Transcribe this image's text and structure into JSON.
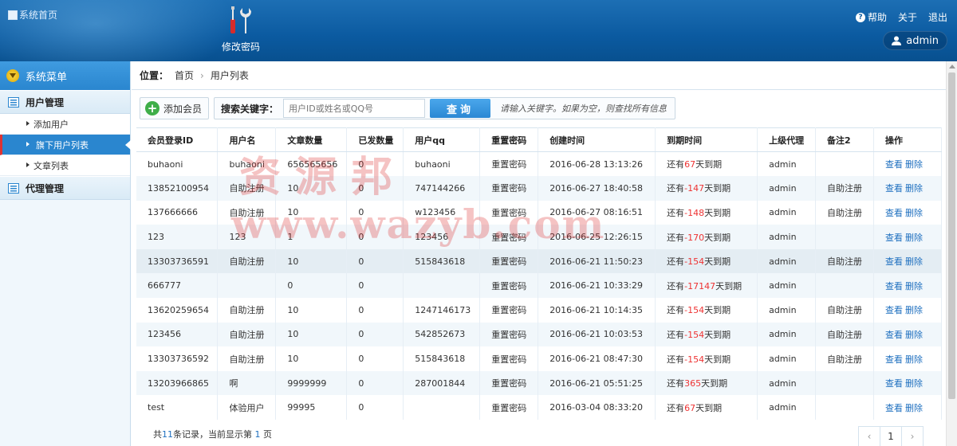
{
  "header": {
    "logo_alt": "系统首页",
    "tool_label": "修改密码",
    "links": {
      "help": "帮助",
      "about": "关于",
      "logout": "退出"
    },
    "user": "admin"
  },
  "sidebar": {
    "title": "系统菜单",
    "groups": [
      {
        "label": "用户管理",
        "items": [
          "添加用户",
          "旗下用户列表",
          "文章列表"
        ]
      },
      {
        "label": "代理管理",
        "items": []
      }
    ]
  },
  "breadcrumb": {
    "label": "位置：",
    "home": "首页",
    "current": "用户列表"
  },
  "toolbar": {
    "add_label": "添加会员",
    "search_label": "搜索关键字：",
    "search_placeholder": "用户ID或姓名或QQ号",
    "search_button": "查询",
    "hint": "请输入关键字。如果为空，则查找所有信息"
  },
  "table": {
    "headers": [
      "会员登录ID",
      "用户名",
      "文章数量",
      "已发数量",
      "用户qq",
      "重置密码",
      "创建时间",
      "到期时间",
      "上级代理",
      "备注2",
      "操作"
    ],
    "reset_label": "重置密码",
    "view_label": "查看",
    "delete_label": "删除",
    "expire_prefix": "还有",
    "expire_suffix": "天到期",
    "rows": [
      {
        "id": "buhaoni",
        "name": "buhaoni",
        "articles": "656565656",
        "sent": "0",
        "qq": "buhaoni",
        "created": "2016-06-28 13:13:26",
        "days": "67",
        "agent": "admin",
        "note": ""
      },
      {
        "id": "13852100954",
        "name": "自助注册",
        "articles": "10",
        "sent": "0",
        "qq": "747144266",
        "created": "2016-06-27 18:40:58",
        "days": "-147",
        "agent": "admin",
        "note": "自助注册"
      },
      {
        "id": "137666666",
        "name": "自助注册",
        "articles": "10",
        "sent": "0",
        "qq": "w123456",
        "created": "2016-06-27 08:16:51",
        "days": "-148",
        "agent": "admin",
        "note": "自助注册"
      },
      {
        "id": "123",
        "name": "123",
        "articles": "1",
        "sent": "0",
        "qq": "123456",
        "created": "2016-06-25 12:26:15",
        "days": "-170",
        "agent": "admin",
        "note": ""
      },
      {
        "id": "13303736591",
        "name": "自助注册",
        "articles": "10",
        "sent": "0",
        "qq": "515843618",
        "created": "2016-06-21 11:50:23",
        "days": "-154",
        "agent": "admin",
        "note": "自助注册"
      },
      {
        "id": "666777",
        "name": "",
        "articles": "0",
        "sent": "0",
        "qq": "",
        "created": "2016-06-21 10:33:29",
        "days": "-17147",
        "agent": "admin",
        "note": ""
      },
      {
        "id": "13620259654",
        "name": "自助注册",
        "articles": "10",
        "sent": "0",
        "qq": "1247146173",
        "created": "2016-06-21 10:14:35",
        "days": "-154",
        "agent": "admin",
        "note": "自助注册"
      },
      {
        "id": "123456",
        "name": "自助注册",
        "articles": "10",
        "sent": "0",
        "qq": "542852673",
        "created": "2016-06-21 10:03:53",
        "days": "-154",
        "agent": "admin",
        "note": "自助注册"
      },
      {
        "id": "13303736592",
        "name": "自助注册",
        "articles": "10",
        "sent": "0",
        "qq": "515843618",
        "created": "2016-06-21 08:47:30",
        "days": "-154",
        "agent": "admin",
        "note": "自助注册"
      },
      {
        "id": "13203966865",
        "name": "啊",
        "articles": "9999999",
        "sent": "0",
        "qq": "287001844",
        "created": "2016-06-21 05:51:25",
        "days": "365",
        "agent": "admin",
        "note": ""
      },
      {
        "id": "test",
        "name": "体验用户",
        "articles": "99995",
        "sent": "0",
        "qq": "",
        "created": "2016-03-04 08:33:20",
        "days": "67",
        "agent": "admin",
        "note": ""
      }
    ]
  },
  "footer": {
    "prefix": "共",
    "total": "11",
    "mid": "条记录，当前显示第 ",
    "page": "1",
    "suffix": " 页"
  },
  "pager": {
    "prev": "‹",
    "page": "1",
    "next": "›"
  },
  "watermark": {
    "line1": "资源邦",
    "line2": "www.wazyb.com"
  }
}
